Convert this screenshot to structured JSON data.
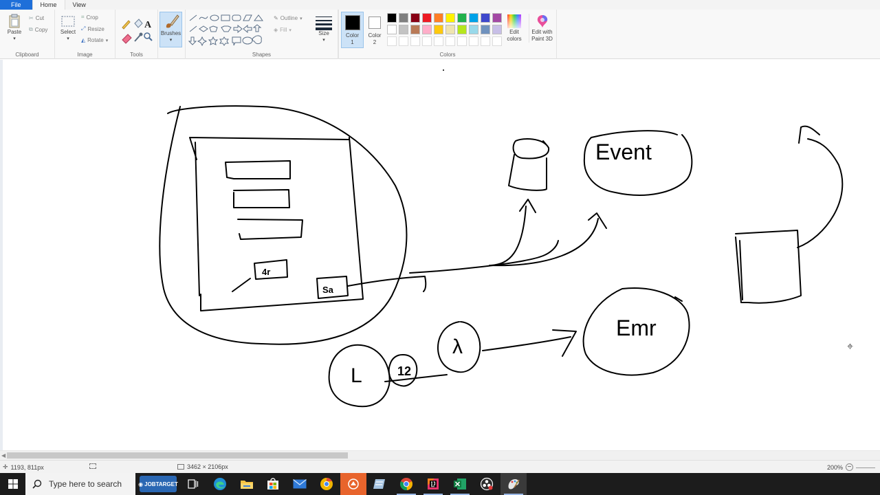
{
  "tabs": {
    "file": "File",
    "home": "Home",
    "view": "View"
  },
  "ribbon": {
    "clipboard": {
      "label": "Clipboard",
      "paste": "Paste",
      "cut": "Cut",
      "copy": "Copy"
    },
    "image": {
      "label": "Image",
      "select": "Select",
      "crop": "Crop",
      "resize": "Resize",
      "rotate": "Rotate"
    },
    "tools": {
      "label": "Tools"
    },
    "brushes": {
      "label": "Brushes"
    },
    "shapes": {
      "label": "Shapes",
      "outline": "Outline",
      "fill": "Fill"
    },
    "size": {
      "label": "Size"
    },
    "colors": {
      "label": "Colors",
      "color1_line1": "Color",
      "color1_line2": "1",
      "color2_line1": "Color",
      "color2_line2": "2",
      "edit_colors_line1": "Edit",
      "edit_colors_line2": "colors",
      "edit_3d_line1": "Edit with",
      "edit_3d_line2": "Paint 3D",
      "color1_value": "#000000",
      "color2_value": "#ffffff",
      "palette_row1": [
        "#000000",
        "#7f7f7f",
        "#880015",
        "#ed1c24",
        "#ff7f27",
        "#fff200",
        "#22b14c",
        "#00a2e8",
        "#3f48cc",
        "#a349a4"
      ],
      "palette_row2": [
        "#ffffff",
        "#c3c3c3",
        "#b97a57",
        "#ffaec9",
        "#ffc90e",
        "#efe4b0",
        "#b5e61d",
        "#99d9ea",
        "#7092be",
        "#c8bfe7"
      ]
    }
  },
  "canvas": {
    "labels": {
      "ec2": "4r",
      "sa": "Sa",
      "events": "Event",
      "emr": "Emr",
      "lambda": "λ",
      "l": "L",
      "num": "12"
    }
  },
  "status": {
    "cursor_pos": "1193, 811px",
    "image_size": "3462 × 2106px",
    "zoom": "200%"
  },
  "taskbar": {
    "search_placeholder": "Type here to search",
    "jobtarget": "JOBTARGET"
  }
}
